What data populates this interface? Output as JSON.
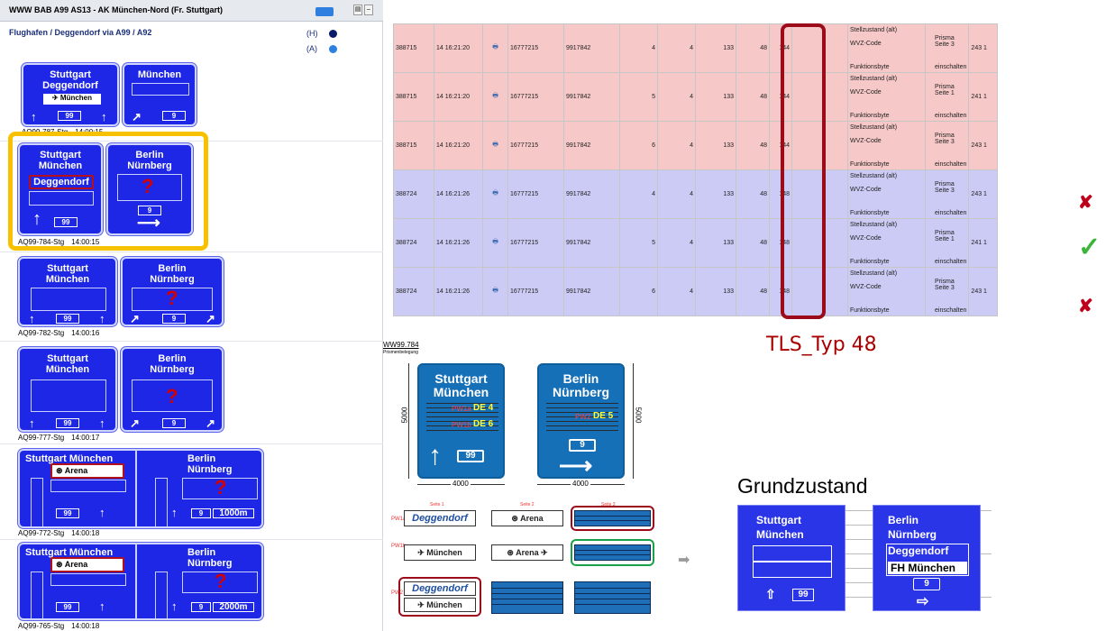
{
  "left_panel": {
    "title": "WWW BAB A99 AS13 - AK München-Nord (Fr. Stuttgart)",
    "route": "Flughafen / Deggendorf via A99 / A92",
    "indicators": [
      {
        "code": "(H)",
        "color": "#0a1a6a"
      },
      {
        "code": "(A)",
        "color": "#2f7fe0"
      }
    ],
    "signs": [
      {
        "left": {
          "l1": "Stuttgart",
          "l2": "Deggendorf",
          "white": "München",
          "num": "99"
        },
        "right": {
          "l1": "München",
          "num": "9"
        },
        "caption_id": "AQ99-787-Stg",
        "caption_time": "14:00:15"
      },
      {
        "left": {
          "l1": "Stuttgart",
          "l2": "München",
          "white": "Deggendorf",
          "num": "99"
        },
        "right": {
          "l1": "Berlin",
          "l2": "Nürnberg",
          "q": "?",
          "num": "9"
        },
        "caption_id": "AQ99-784-Stg",
        "caption_time": "14:00:15"
      },
      {
        "left": {
          "l1": "Stuttgart",
          "l2": "München",
          "num": "99"
        },
        "right": {
          "l1": "Berlin",
          "l2": "Nürnberg",
          "q": "?",
          "num": "9"
        },
        "caption_id": "AQ99-782-Stg",
        "caption_time": "14:00:16"
      },
      {
        "left": {
          "l1": "Stuttgart",
          "l2": "München",
          "num": "99"
        },
        "right": {
          "l1": "Berlin",
          "l2": "Nürnberg",
          "q": "?",
          "num": "9"
        },
        "caption_id": "AQ99-777-Stg",
        "caption_time": "14:00:17"
      },
      {
        "left": {
          "l1": "Stuttgart München",
          "white": "Arena",
          "num": "99"
        },
        "right": {
          "l1": "Berlin",
          "l2": "Nürnberg",
          "q": "?",
          "num": "9",
          "dist": "1000m"
        },
        "caption_id": "AQ99-772-Stg",
        "caption_time": "14:00:18"
      },
      {
        "left": {
          "l1": "Stuttgart München",
          "white": "Arena",
          "num": "99"
        },
        "right": {
          "l1": "Berlin",
          "l2": "Nürnberg",
          "q": "?",
          "num": "9",
          "dist": "2000m"
        },
        "caption_id": "AQ99-765-Stg",
        "caption_time": "14:00:18"
      }
    ]
  },
  "table": {
    "rows": [
      {
        "tone": "red",
        "c": [
          "388715",
          "14 16:21:20",
          "16777215",
          "9917842",
          "4",
          "4",
          "133",
          "48",
          "144"
        ],
        "s1": "Stellzustand (alt)",
        "s2": "WVZ-Code",
        "s3": "Funktionsbyte",
        "p1": "Prisma Seite 3",
        "p2": "einschalten",
        "code": "243 1"
      },
      {
        "tone": "red",
        "c": [
          "388715",
          "14 16:21:20",
          "16777215",
          "9917842",
          "5",
          "4",
          "133",
          "48",
          "144"
        ],
        "s1": "Stellzustand (alt)",
        "s2": "WVZ-Code",
        "s3": "Funktionsbyte",
        "p1": "Prisma Seite 1",
        "p2": "einschalten",
        "code": "241 1"
      },
      {
        "tone": "red",
        "c": [
          "388715",
          "14 16:21:20",
          "16777215",
          "9917842",
          "6",
          "4",
          "133",
          "48",
          "144"
        ],
        "s1": "Stellzustand (alt)",
        "s2": "WVZ-Code",
        "s3": "Funktionsbyte",
        "p1": "Prisma Seite 3",
        "p2": "einschalten",
        "code": "243 1"
      },
      {
        "tone": "blue",
        "c": [
          "388724",
          "14 16:21:26",
          "16777215",
          "9917842",
          "4",
          "4",
          "133",
          "48",
          "148"
        ],
        "s1": "Stellzustand (alt)",
        "s2": "WVZ-Code",
        "s3": "Funktionsbyte",
        "p1": "Prisma Seite 3",
        "p2": "einschalten",
        "code": "243 1"
      },
      {
        "tone": "blue",
        "c": [
          "388724",
          "14 16:21:26",
          "16777215",
          "9917842",
          "5",
          "4",
          "133",
          "48",
          "148"
        ],
        "s1": "Stellzustand (alt)",
        "s2": "WVZ-Code",
        "s3": "Funktionsbyte",
        "p1": "Prisma Seite 1",
        "p2": "einschalten",
        "code": "241 1"
      },
      {
        "tone": "blue",
        "c": [
          "388724",
          "14 16:21:26",
          "16777215",
          "9917842",
          "6",
          "4",
          "133",
          "48",
          "148"
        ],
        "s1": "Stellzustand (alt)",
        "s2": "WVZ-Code",
        "s3": "Funktionsbyte",
        "p1": "Prisma Seite 3",
        "p2": "einschalten",
        "code": "243 1"
      }
    ],
    "tls_label": "TLS_Typ 48",
    "marks": [
      "✘",
      "✓",
      "✘"
    ]
  },
  "drawing": {
    "id": "WW99.784",
    "subtitle": "Prismenbelegung",
    "left_sign": {
      "l1": "Stuttgart",
      "l2": "München",
      "pw1": "PW1a",
      "de1": "DE 4",
      "pw2": "PW1b",
      "de2": "DE 6",
      "num": "99"
    },
    "right_sign": {
      "l1": "Berlin",
      "l2": "Nürnberg",
      "pw": "PW2",
      "de": "DE 5",
      "num": "9"
    },
    "dims": {
      "height": "5000",
      "width": "4000"
    },
    "seiten": [
      "Seite 1",
      "Seite 2",
      "Seite 3"
    ],
    "pw_labels": [
      "PW1a",
      "PW1b",
      "PW2"
    ],
    "prism_text": {
      "deggendorf": "Deggendorf",
      "arena": "Arena",
      "muenchen": "München"
    }
  },
  "grund": {
    "title": "Grundzustand",
    "left": {
      "l1": "Stuttgart",
      "l2": "München",
      "num": "99"
    },
    "right": {
      "l1": "Berlin",
      "l2": "Nürnberg",
      "w1": "Deggendorf",
      "w2": "FH München",
      "num": "9"
    }
  },
  "colors": {
    "sign_blue": "#1f27e6",
    "highlight_yellow": "#f6c200",
    "mark_red": "#9c0b19",
    "mark_green": "#19a24a"
  }
}
